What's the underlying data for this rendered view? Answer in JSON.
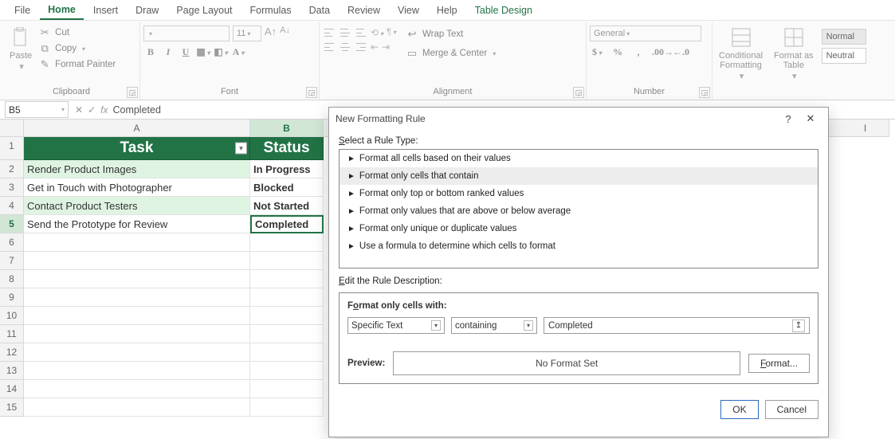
{
  "menu": {
    "items": [
      "File",
      "Home",
      "Insert",
      "Draw",
      "Page Layout",
      "Formulas",
      "Data",
      "Review",
      "View",
      "Help",
      "Table Design"
    ],
    "active": "Home"
  },
  "ribbon": {
    "clipboard": {
      "label": "Clipboard",
      "paste": "Paste",
      "cut": "Cut",
      "copy": "Copy",
      "painter": "Format Painter"
    },
    "font": {
      "label": "Font",
      "size": "11"
    },
    "alignment": {
      "label": "Alignment",
      "wrap": "Wrap Text",
      "merge": "Merge & Center"
    },
    "number": {
      "label": "Number",
      "format": "General"
    },
    "styles": {
      "conditional": "Conditional\nFormatting",
      "formatas": "Format as\nTable",
      "normal": "Normal",
      "neutral": "Neutral"
    }
  },
  "formula_bar": {
    "cell_ref": "B5",
    "fx": "fx",
    "value": "Completed"
  },
  "sheet": {
    "columns": [
      "A",
      "B",
      "I"
    ],
    "col_widths": {
      "A": 284,
      "B": 92
    },
    "headers": {
      "task": "Task",
      "status": "Status"
    },
    "rows": [
      {
        "task": "Render Product Images",
        "status": "In Progress"
      },
      {
        "task": "Get in Touch with Photographer",
        "status": "Blocked"
      },
      {
        "task": "Contact Product Testers",
        "status": "Not Started"
      },
      {
        "task": "Send the Prototype for Review",
        "status": "Completed"
      }
    ],
    "active_cell": "B5"
  },
  "dialog": {
    "title": "New Formatting Rule",
    "section_rule_type": "Select a Rule Type:",
    "rule_types": [
      "Format all cells based on their values",
      "Format only cells that contain",
      "Format only top or bottom ranked values",
      "Format only values that are above or below average",
      "Format only unique or duplicate values",
      "Use a formula to determine which cells to format"
    ],
    "selected_rule_type_index": 1,
    "section_edit_desc": "Edit the Rule Description:",
    "format_label": "Format only cells with:",
    "criterion_type": "Specific Text",
    "criterion_op": "containing",
    "criterion_value": "Completed",
    "preview_label": "Preview:",
    "preview_text": "No Format Set",
    "format_button": "Format...",
    "ok": "OK",
    "cancel": "Cancel"
  }
}
